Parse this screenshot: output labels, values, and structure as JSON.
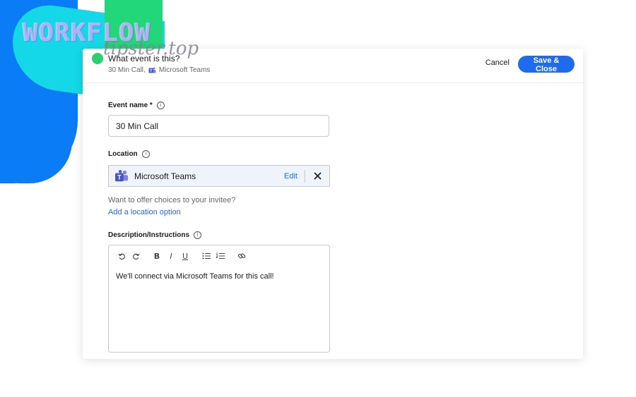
{
  "watermark": {
    "top": "WORKFLOW",
    "bottom": "tipster.top"
  },
  "header": {
    "title": "What event is this?",
    "subtitle_duration": "30 Min Call,",
    "subtitle_location": "Microsoft Teams",
    "cancel_label": "Cancel",
    "save_label": "Save & Close"
  },
  "event_name": {
    "label": "Event name *",
    "value": "30 Min Call"
  },
  "location": {
    "label": "Location",
    "name": "Microsoft Teams",
    "edit_label": "Edit",
    "hint": "Want to offer choices to your invitee?",
    "add_link": "Add a location option"
  },
  "description": {
    "label": "Description/Instructions",
    "text": "We'll connect via Microsoft Teams for this call!",
    "toolbar": [
      "undo-icon",
      "redo-icon",
      "bold-icon",
      "italic-icon",
      "underline-icon",
      "bulleted-list-icon",
      "numbered-list-icon",
      "link-icon"
    ]
  },
  "colors": {
    "accent": "#1f6bf0",
    "status": "#2ccf6f",
    "location_bg": "#eef3fc"
  }
}
